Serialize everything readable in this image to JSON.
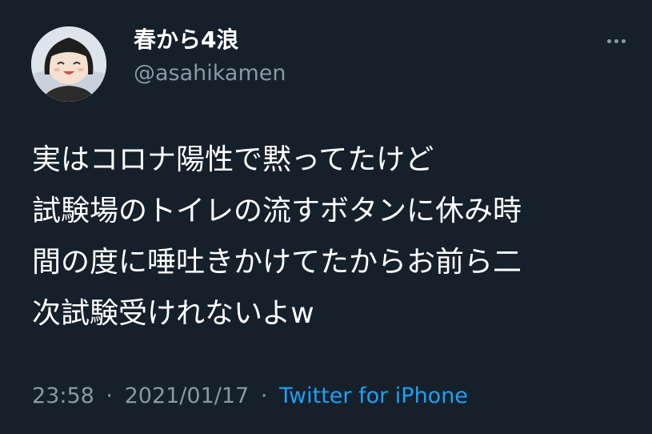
{
  "colors": {
    "background": "#15202b",
    "primary_text": "#ffffff",
    "secondary_text": "#8899a6",
    "link": "#1da1f2"
  },
  "user": {
    "display_name": "春から4浪",
    "handle": "@asahikamen",
    "avatar_icon": "anime-girl-avatar"
  },
  "more_icon": "more-horizontal-icon",
  "tweet": {
    "lines": [
      "実はコロナ陽性で黙ってたけど",
      "試験場のトイレの流すボタンに休み時",
      "間の度に唾吐きかけてたからお前ら二",
      "次試験受けれないよw"
    ]
  },
  "meta": {
    "time": "23:58",
    "separator": "·",
    "date": "2021/01/17",
    "source": "Twitter for iPhone"
  }
}
